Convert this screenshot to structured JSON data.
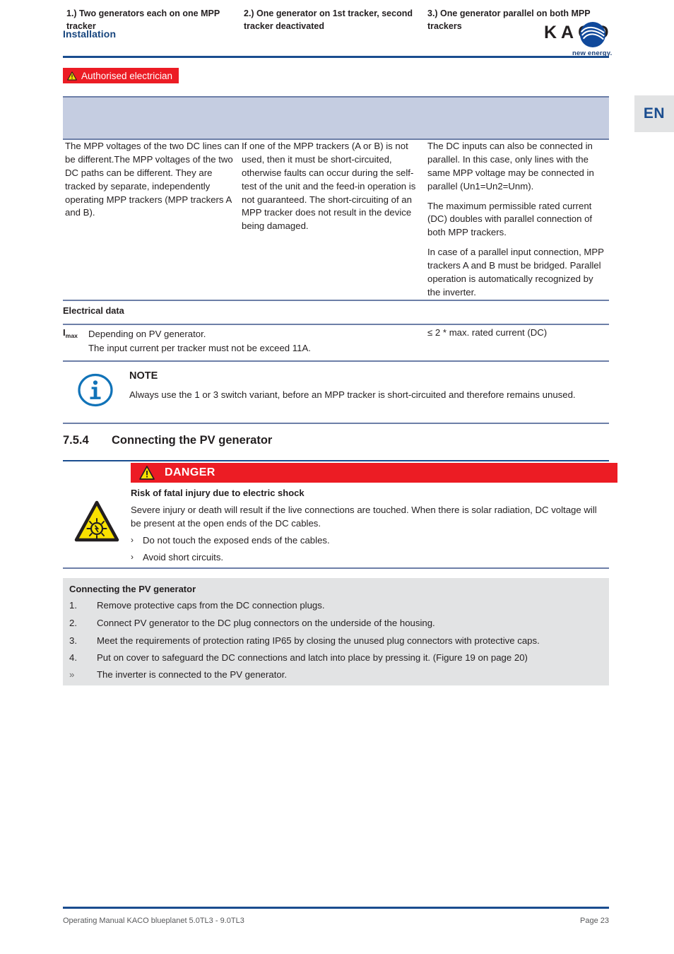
{
  "header": {
    "section_title": "Installation",
    "logo_text": "KACO",
    "logo_tagline": "new energy.",
    "language_tab": "EN"
  },
  "audience_badge": {
    "label": "Authorised electrician",
    "icon": "warning-triangle-icon",
    "background": "#ec1c24",
    "text_color": "#ffffff"
  },
  "comparison_table": {
    "header_background": "#c5cde1",
    "columns": [
      {
        "heading": "1.) Two generators each on one MPP tracker",
        "paragraphs": [
          "The MPP voltages of the two DC lines can be different.The MPP voltages of the two DC paths can be different. They are tracked by separate, independently operating MPP trackers (MPP trackers A and B)."
        ]
      },
      {
        "heading": "2.) One generator on 1st tracker, second  tracker deactivated",
        "paragraphs": [
          "If one of the MPP trackers (A or B) is not used, then it must be short-circuited, otherwise faults can occur during the self-test of the unit and the feed-in operation is not guaranteed. The short-circuiting of an MPP tracker does not result in the device being damaged."
        ]
      },
      {
        "heading": "3.) One generator parallel on both MPP trackers",
        "paragraphs": [
          "The DC inputs can also be connected in parallel. In this case, only lines with the same MPP voltage may be connected in parallel (Un1=Un2=Unm).",
          "The maximum permissible rated current (DC) doubles with parallel connection of both MPP trackers.",
          "In case of a parallel input connection, MPP trackers A and B must be bridged. Parallel operation is automatically recognized by the inverter."
        ]
      }
    ]
  },
  "electrical_data": {
    "title": "Electrical data",
    "symbol": "I",
    "symbol_subscript": "max",
    "description_line_1": "Depending on PV generator.",
    "description_line_2": "The input current per tracker must not be exceed 11A.",
    "value": "≤ 2 * max. rated current (DC)"
  },
  "note": {
    "icon": "info-circle-icon",
    "title": "NOTE",
    "body": "Always use the 1 or 3 switch variant, before an MPP tracker is short-circuited and therefore remains unused."
  },
  "section": {
    "number": "7.5.4",
    "title": "Connecting the PV generator"
  },
  "danger": {
    "icon": "warning-triangle-icon",
    "label": "DANGER",
    "background": "#ec1c24",
    "subtitle": "Risk of fatal injury due to electric shock",
    "hazard_icon": "solar-radiation-hazard-icon",
    "body": "Severe injury or death will result if the live connections are touched. When there is solar radiation, DC voltage will be present at the open ends of the DC cables.",
    "bullets": [
      {
        "marker": "›",
        "text": "Do not touch the exposed ends of the cables."
      },
      {
        "marker": "›",
        "text": "Avoid short circuits."
      }
    ]
  },
  "procedure": {
    "background": "#e2e3e4",
    "title": "Connecting the PV generator",
    "steps": [
      {
        "marker": "1.",
        "text": "Remove protective caps from the DC connection plugs."
      },
      {
        "marker": "2.",
        "text": "Connect PV generator to the DC plug connectors on the underside of the housing."
      },
      {
        "marker": "3.",
        "text": "Meet the requirements of protection rating IP65 by closing the unused plug connectors with protective caps."
      },
      {
        "marker": "4.",
        "text": "Put on cover to safeguard the DC connections and latch into place by pressing it.  (Figure 19 on page 20)"
      },
      {
        "marker": "»",
        "text": "The inverter is connected to the PV generator."
      }
    ]
  },
  "footer": {
    "left": "Operating Manual KACO blueplanet 5.0TL3 - 9.0TL3",
    "right": "Page 23"
  }
}
